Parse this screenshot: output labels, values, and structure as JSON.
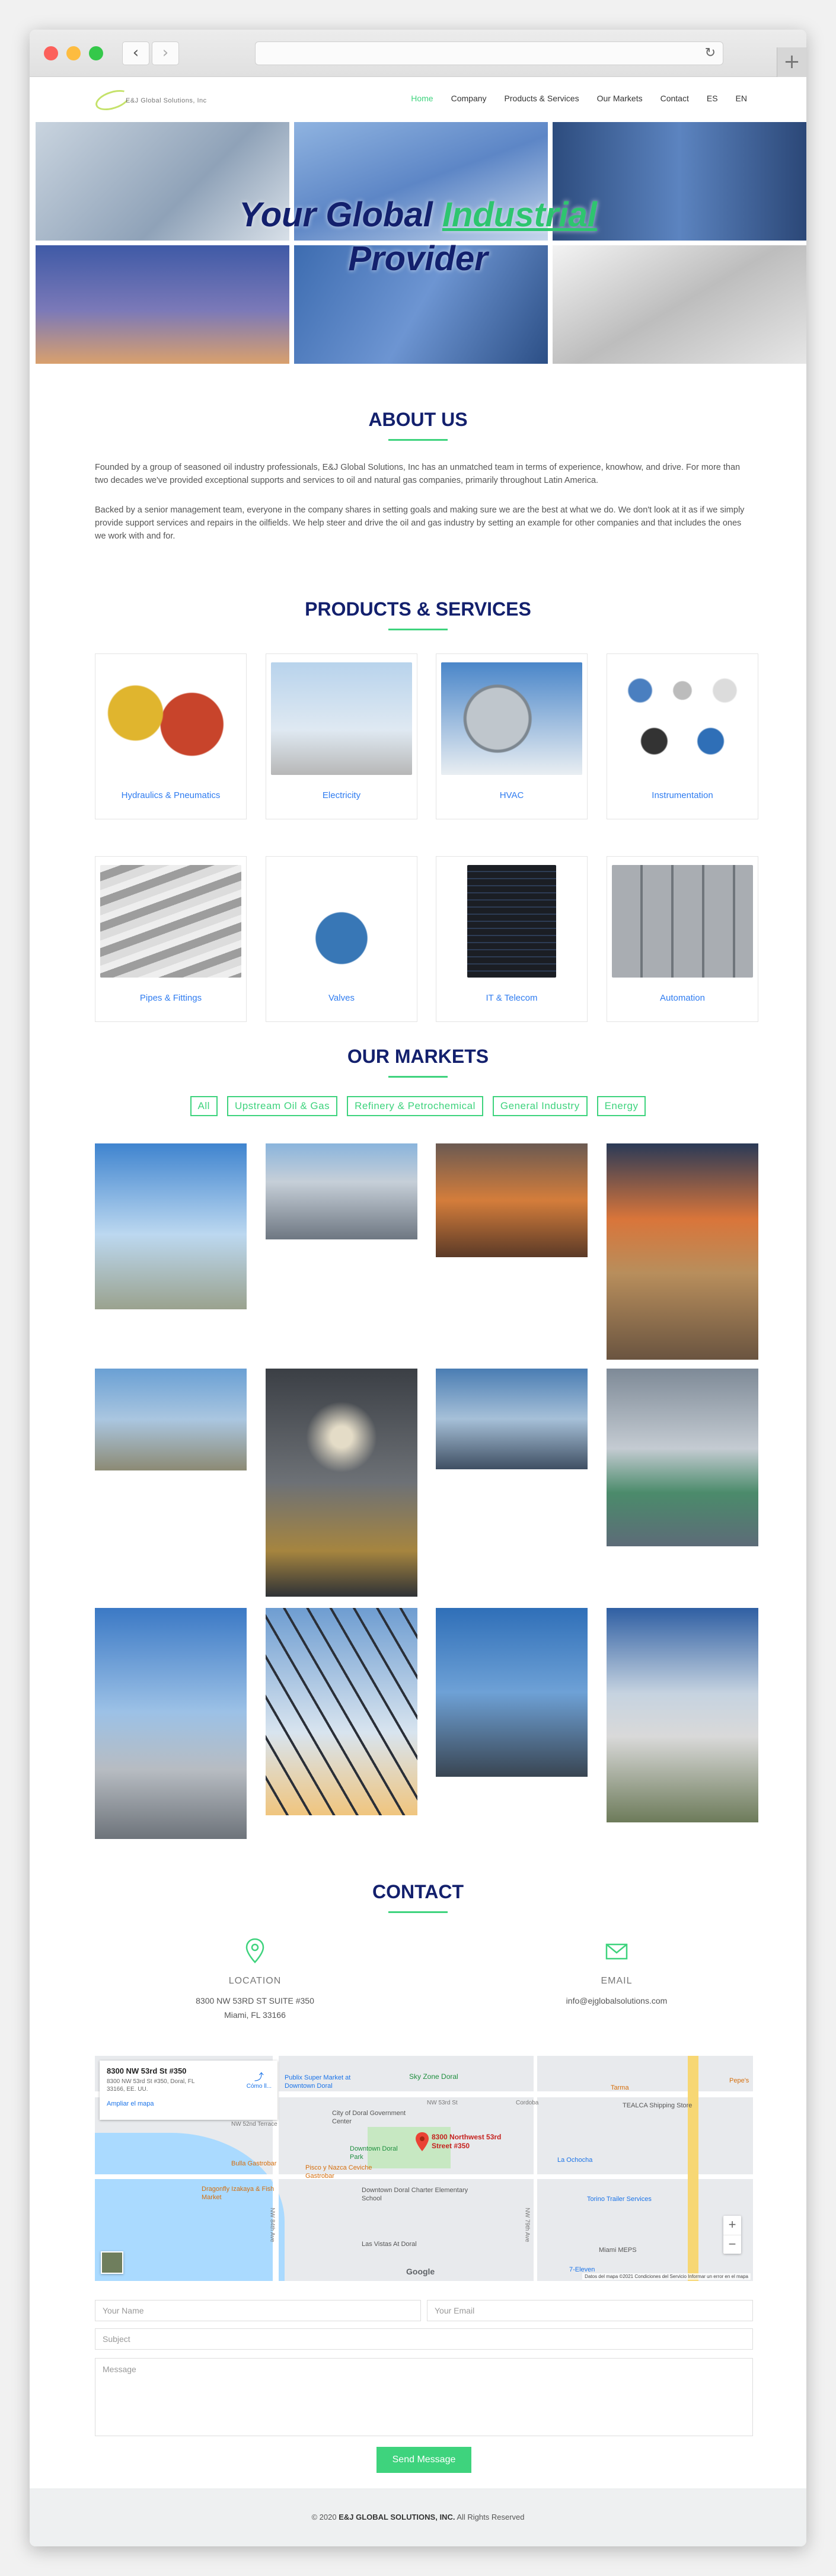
{
  "nav": {
    "logo_text": "E&J Global Solutions, Inc",
    "items": [
      "Home",
      "Company",
      "Products & Services",
      "Our Markets",
      "Contact",
      "ES",
      "EN"
    ]
  },
  "hero": {
    "title_part1": "Your Global ",
    "title_highlight": "Industrial",
    "title_part2": "Provider"
  },
  "about": {
    "title": "ABOUT US",
    "para1": "Founded by a group of seasoned oil industry professionals, E&J Global Solutions, Inc has an unmatched team in terms of experience, knowhow, and drive. For more than two decades we've provided exceptional supports and services to oil and natural gas companies, primarily throughout Latin America.",
    "para2": "Backed by a senior management team, everyone in the company shares in setting goals and making sure we are the best at what we do. We don't look at it as if we simply provide support services and repairs in the oilfields. We help steer and drive the oil and gas industry by setting an example for other companies and that includes the ones we work with and for."
  },
  "products": {
    "title": "PRODUCTS & SERVICES",
    "items": [
      "Hydraulics & Pneumatics",
      "Electricity",
      "HVAC",
      "Instrumentation",
      "Pipes & Fittings",
      "Valves",
      "IT & Telecom",
      "Automation"
    ]
  },
  "markets": {
    "title": "OUR MARKETS",
    "filters": [
      "All",
      "Upstream Oil & Gas",
      "Refinery & Petrochemical",
      "General Industry",
      "Energy"
    ]
  },
  "contact": {
    "title": "CONTACT",
    "location_label": "LOCATION",
    "location_line1": "8300 NW 53RD ST SUITE #350",
    "location_line2": "Miami, FL 33166",
    "email_label": "EMAIL",
    "email_value": "info@ejglobalsolutions.com"
  },
  "map": {
    "card_title": "8300 NW 53rd St #350",
    "card_address": "8300 NW 53rd St #350, Doral, FL 33166, EE. UU.",
    "card_link": "Ampliar el mapa",
    "directions": "Cómo ll...",
    "pin_label": "8300 Northwest 53rd Street #350",
    "places": [
      "Sky Zone Doral",
      "Publix Super Market at Downtown Doral",
      "City of Doral Government Center",
      "Downtown Doral Park",
      "Bulla Gastrobar",
      "Pisco y Nazca Ceviche Gastrobar",
      "Downtown Doral Charter Elementary School",
      "Dragonfly Izakaya & Fish Market",
      "Las Vistas At Doral",
      "La Ochocha",
      "TEALCA Shipping Store",
      "Torino Trailer Services",
      "Miami MEPS",
      "7-Eleven",
      "Tarma",
      "Pepe's"
    ],
    "streets": [
      "NW 53rd St",
      "Cordoba",
      "NW 52nd Terrace",
      "NW 84th Ave",
      "NW 79th Ave"
    ],
    "google": "Google",
    "attribution": "Datos del mapa ©2021   Condiciones del Servicio   Informar un error en el mapa",
    "zoom_in": "+",
    "zoom_out": "−"
  },
  "form": {
    "name_placeholder": "Your Name",
    "email_placeholder": "Your Email",
    "subject_placeholder": "Subject",
    "message_placeholder": "Message",
    "send_label": "Send Message"
  },
  "footer": {
    "prefix": "© 2020 ",
    "company": "E&J GLOBAL SOLUTIONS, INC.",
    "suffix": " All Rights Reserved"
  },
  "colors": {
    "navy": "#13206d",
    "green": "#3ed37d",
    "link_blue": "#2f7cf0"
  }
}
